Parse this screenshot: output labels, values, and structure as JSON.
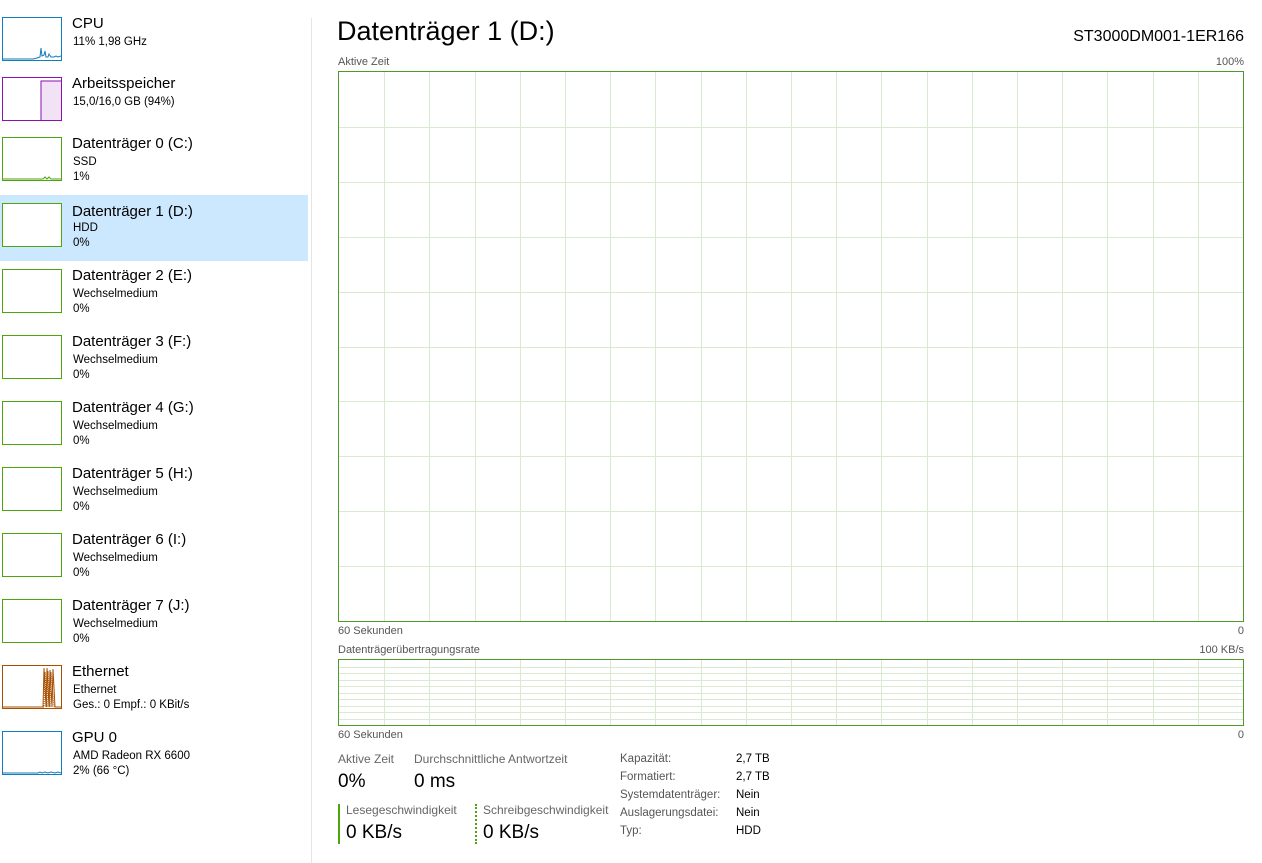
{
  "colors": {
    "cpu": "#117dbb",
    "memory": "#8b12ae",
    "disk": "#4da60c",
    "ethernet": "#a74f01",
    "gpu": "#117dbb",
    "selected_bg": "#cce8ff",
    "chart_border": "#4c9a2a",
    "chart_grid": "#d9ead0"
  },
  "sidebar": {
    "items": [
      {
        "title": "CPU",
        "sub1": "11%  1,98 GHz",
        "sub2": "",
        "icon": "cpu-graph",
        "kind": "cpu"
      },
      {
        "title": "Arbeitsspeicher",
        "sub1": "15,0/16,0 GB (94%)",
        "sub2": "",
        "icon": "memory-graph",
        "kind": "memory"
      },
      {
        "title": "Datenträger 0 (C:)",
        "sub1": "SSD",
        "sub2": "1%",
        "icon": "disk-graph",
        "kind": "disk"
      },
      {
        "title": "Datenträger 1 (D:)",
        "sub1": "HDD",
        "sub2": "0%",
        "icon": "disk-graph",
        "kind": "disk",
        "selected": true
      },
      {
        "title": "Datenträger 2 (E:)",
        "sub1": "Wechselmedium",
        "sub2": "0%",
        "icon": "disk-graph",
        "kind": "disk"
      },
      {
        "title": "Datenträger 3 (F:)",
        "sub1": "Wechselmedium",
        "sub2": "0%",
        "icon": "disk-graph",
        "kind": "disk"
      },
      {
        "title": "Datenträger 4 (G:)",
        "sub1": "Wechselmedium",
        "sub2": "0%",
        "icon": "disk-graph",
        "kind": "disk"
      },
      {
        "title": "Datenträger 5 (H:)",
        "sub1": "Wechselmedium",
        "sub2": "0%",
        "icon": "disk-graph",
        "kind": "disk"
      },
      {
        "title": "Datenträger 6 (I:)",
        "sub1": "Wechselmedium",
        "sub2": "0%",
        "icon": "disk-graph",
        "kind": "disk"
      },
      {
        "title": "Datenträger 7 (J:)",
        "sub1": "Wechselmedium",
        "sub2": "0%",
        "icon": "disk-graph",
        "kind": "disk"
      },
      {
        "title": "Ethernet",
        "sub1": "Ethernet",
        "sub2": "Ges.: 0 Empf.: 0 KBit/s",
        "icon": "ethernet-graph",
        "kind": "ethernet"
      },
      {
        "title": "GPU 0",
        "sub1": "AMD Radeon RX 6600",
        "sub2": "2%  (66 °C)",
        "icon": "gpu-graph",
        "kind": "gpu"
      }
    ]
  },
  "main": {
    "title": "Datenträger 1 (D:)",
    "model": "ST3000DM001-1ER166",
    "active_time_chart": {
      "label": "Aktive Zeit",
      "max_label": "100%",
      "time_label": "60 Sekunden",
      "min_label": "0"
    },
    "transfer_chart": {
      "label": "Datenträgerübertragungsrate",
      "max_label": "100 KB/s",
      "time_label": "60 Sekunden",
      "min_label": "0"
    }
  },
  "stats": {
    "active_time": {
      "label": "Aktive Zeit",
      "value": "0%"
    },
    "avg_response": {
      "label": "Durchschnittliche Antwortzeit",
      "value": "0 ms"
    },
    "read_speed": {
      "label": "Lesegeschwindigkeit",
      "value": "0 KB/s"
    },
    "write_speed": {
      "label": "Schreibgeschwindigkeit",
      "value": "0 KB/s"
    }
  },
  "info": [
    {
      "key": "Kapazität:",
      "value": "2,7 TB"
    },
    {
      "key": "Formatiert:",
      "value": "2,7 TB"
    },
    {
      "key": "Systemdatenträger:",
      "value": "Nein"
    },
    {
      "key": "Auslagerungsdatei:",
      "value": "Nein"
    },
    {
      "key": "Typ:",
      "value": "HDD"
    }
  ]
}
